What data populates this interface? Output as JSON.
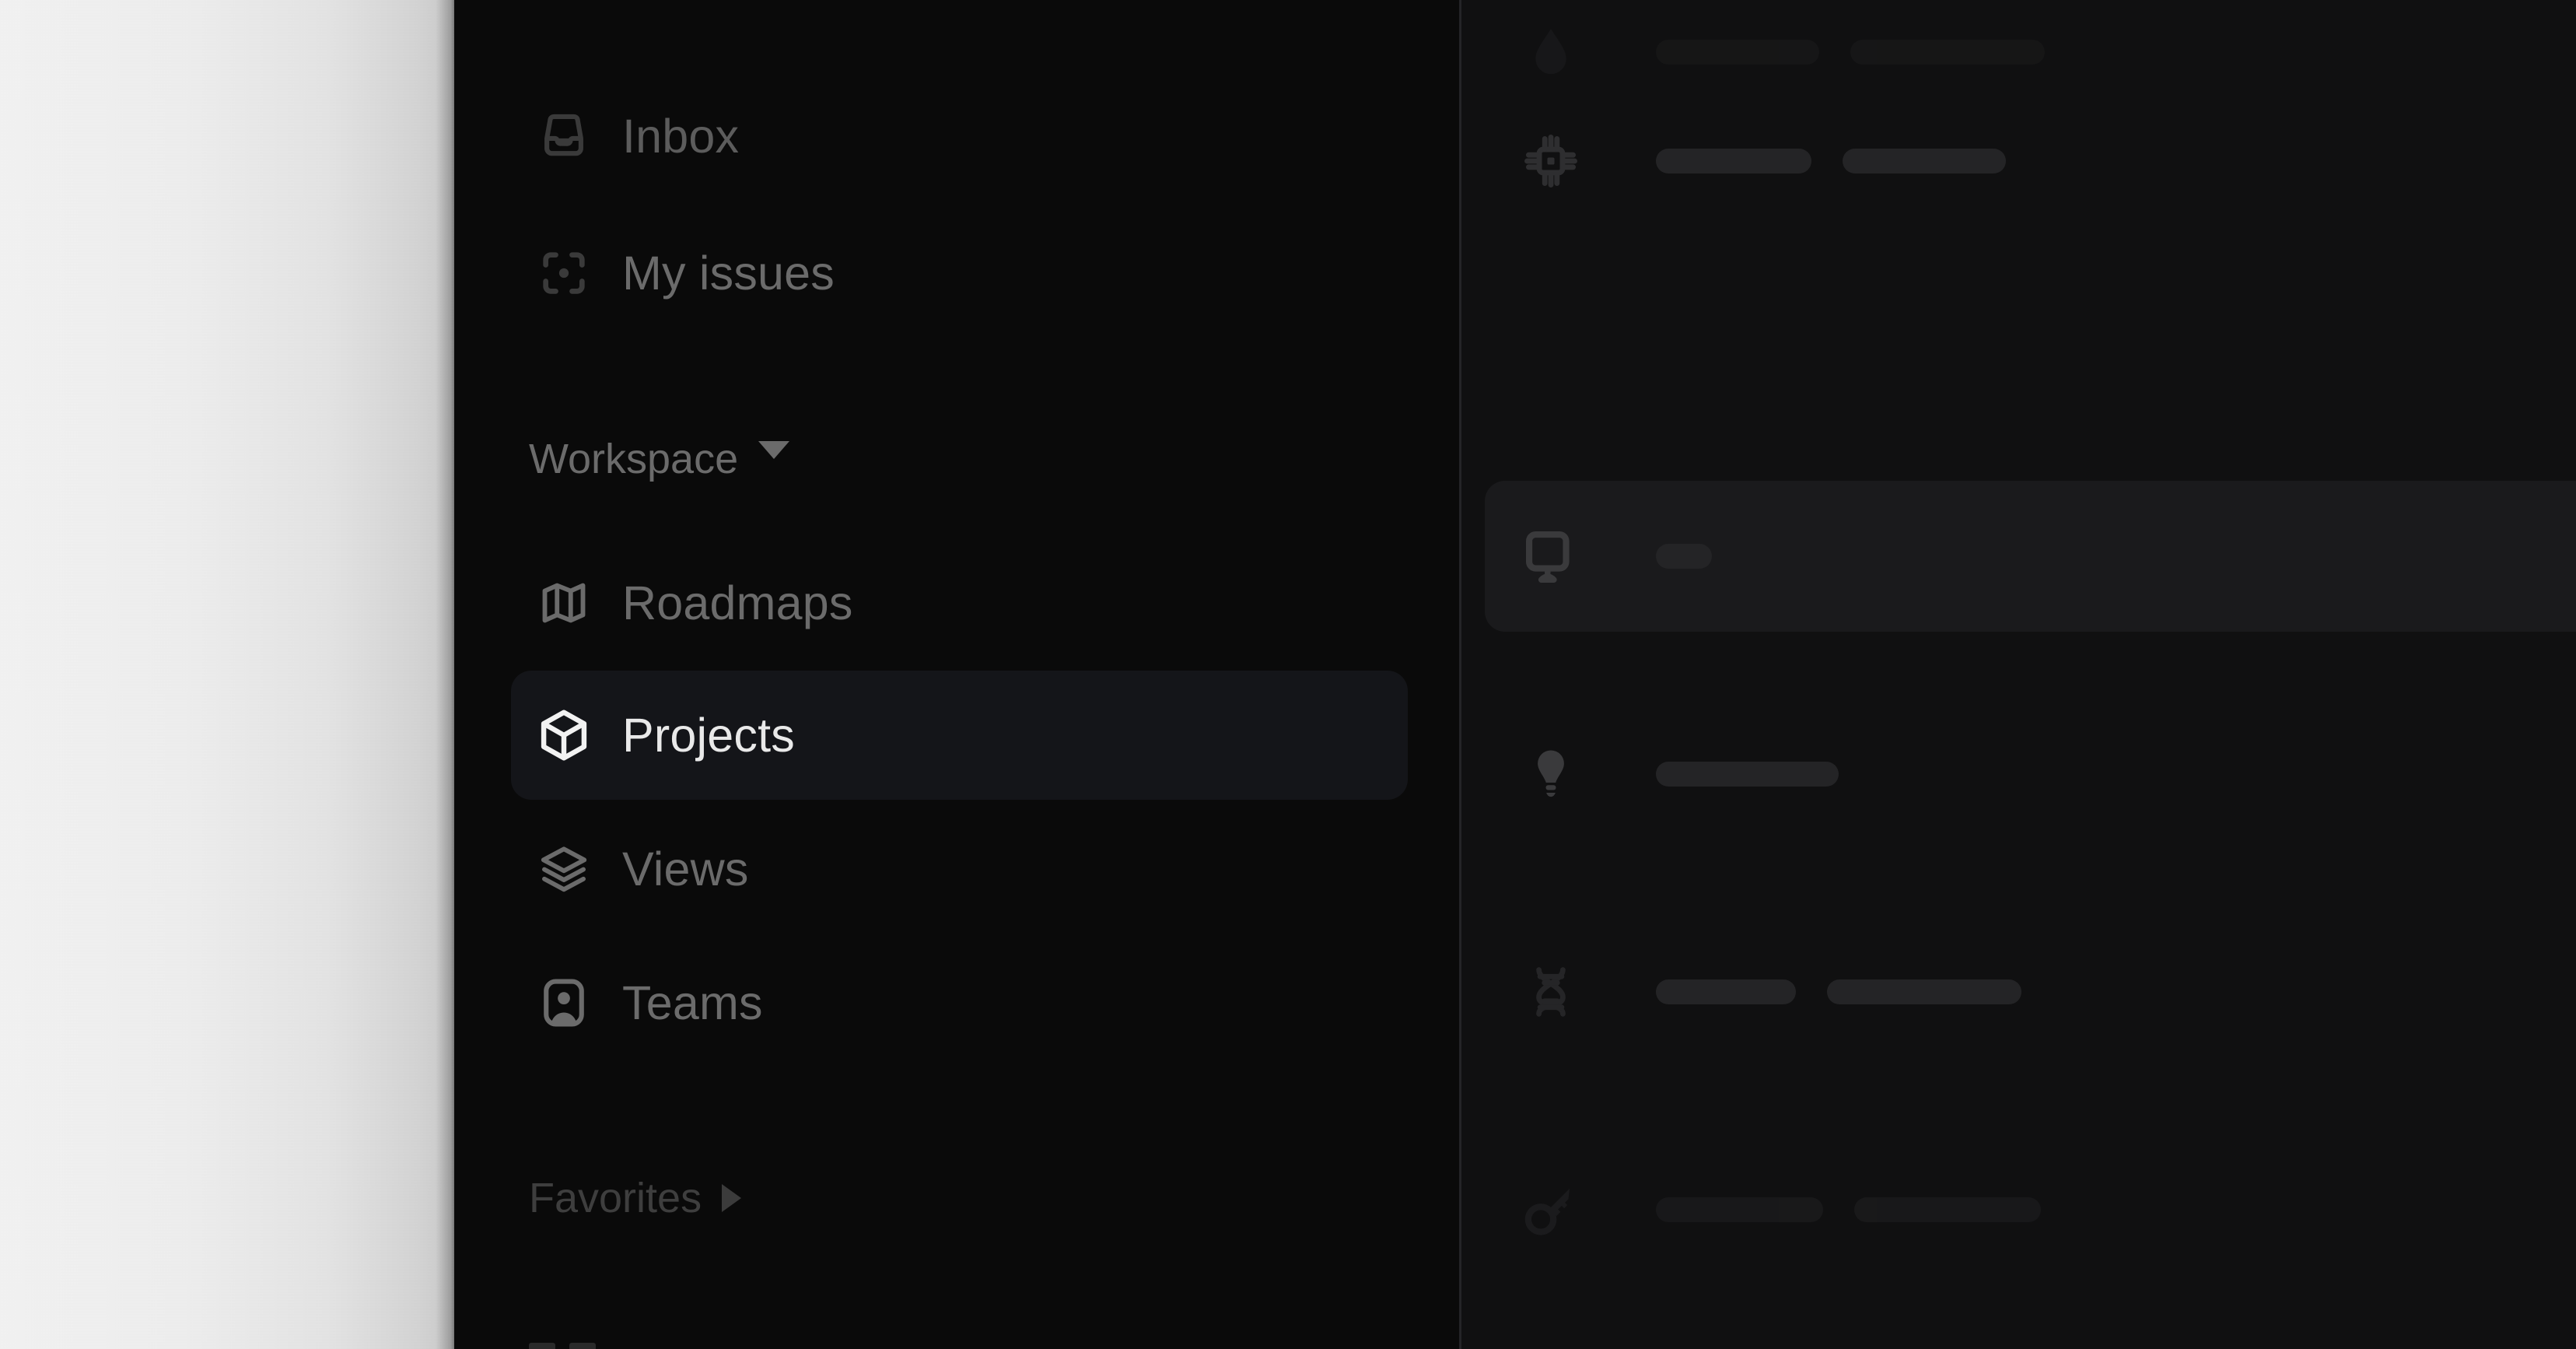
{
  "app": {
    "theme": "dark",
    "colors": {
      "sidebar_bg": "#0a0a0a",
      "content_bg": "#101011",
      "active_item_bg": "#141519",
      "active_row_bg": "#1a1a1c",
      "divider": "#242427",
      "skeleton_bar": "#242426",
      "label_dim": "#5c5c5c",
      "label_bright": "#e9e9e9",
      "page_surface": "#eeeeee"
    }
  },
  "page_surface": {
    "name": "document-canvas"
  },
  "sidebar": {
    "top_button": {
      "name": "clipped-rounded-button",
      "label": ""
    },
    "primary_items": [
      {
        "label": "Inbox",
        "icon": "inbox-icon",
        "active": false
      },
      {
        "label": "My issues",
        "icon": "target-icon",
        "active": false
      }
    ],
    "sections": [
      {
        "title": "Workspace",
        "caret": "chevron-down-icon",
        "expanded": true,
        "items": [
          {
            "label": "Roadmaps",
            "icon": "map-icon",
            "active": false
          },
          {
            "label": "Projects",
            "icon": "cube-icon",
            "active": true
          },
          {
            "label": "Views",
            "icon": "layers-icon",
            "active": false
          },
          {
            "label": "Teams",
            "icon": "contact-icon",
            "active": false
          }
        ]
      },
      {
        "title": "Favorites",
        "caret": "chevron-right-icon",
        "expanded": false,
        "items": []
      }
    ]
  },
  "content": {
    "rows": [
      {
        "icon": "droplet-icon",
        "active": false,
        "bars": [
          210,
          250
        ],
        "opacity": 0.3
      },
      {
        "icon": "chip-icon",
        "active": false,
        "bars": [
          200,
          210
        ],
        "opacity": 1.0
      },
      {
        "icon": "monitor-icon",
        "active": true,
        "bars": [
          72
        ],
        "opacity": 1.0
      },
      {
        "icon": "bulb-icon",
        "active": false,
        "bars": [
          235
        ],
        "opacity": 1.0
      },
      {
        "icon": "dna-icon",
        "active": false,
        "bars": [
          180,
          250
        ],
        "opacity": 1.0
      },
      {
        "icon": "key-icon",
        "active": false,
        "bars": [
          215,
          240
        ],
        "opacity": 0.45
      }
    ]
  }
}
